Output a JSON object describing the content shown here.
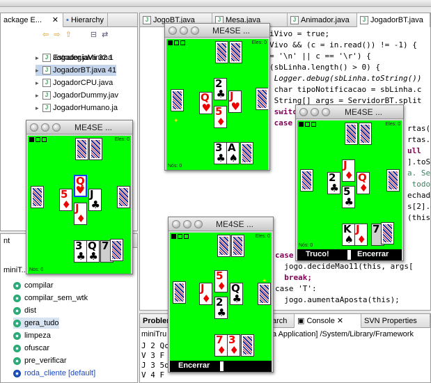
{
  "eclipse": {
    "left_tabs": [
      "ackage E...",
      "Hierarchy"
    ],
    "editor_tabs": [
      "JogoBT.java",
      "Mesa.java",
      "Animador.java",
      "JogadorBT.java"
    ],
    "tree_items": [
      {
        "label": "EstrategiaMinima"
      },
      {
        "label": "Jogador.java 32 1"
      },
      {
        "label": "JogadorBT.java 41"
      },
      {
        "label": "JogadorCPU.java"
      },
      {
        "label": "JogadorDummy.jav"
      },
      {
        "label": "JogadorHumano.ja"
      }
    ],
    "ant_tab": "nt",
    "ant_root": "miniT...",
    "ant_targets": [
      "compilar",
      "compilar_sem_wtk",
      "dist",
      "gera_tudo",
      "limpeza",
      "ofuscar",
      "pre_verificar",
      "roda_cliente [default]"
    ],
    "code_lines": [
      "iVivo = true;",
      "Vivo && (c = in.read()) != -1) {",
      "= '\\n' || c == '\\r') {",
      "(sbLinha.length() > 0) {",
      " Logger.debug(sbLinha.toString())",
      " char tipoNotificacao = sbLinha.c",
      " String[] args = ServidorBT.split",
      " switch",
      " case"
    ],
    "code_lines_lower": [
      "case",
      "  jogo.decideMao11(this, args[",
      "  break;",
      "case 'T':",
      "  jogo.aumentaAposta(this);"
    ],
    "code_fragments": [
      "rtas(",
      "rtas.l",
      "ull",
      "].toS",
      "a. Se",
      " todos",
      "echada",
      "s[2].e",
      "(this,"
    ],
    "bottom_tabs": [
      "Problem",
      "arch",
      "Console",
      "SVN Properties"
    ],
    "console_header": "miniTru",
    "console_path": "a Application] /System/Library/Framework",
    "console_lines": [
      "J 2 Qc",
      "V 3 F",
      "J 3 5o",
      "V 4 F"
    ]
  },
  "emulators": [
    {
      "title": "ME4SE ...",
      "score_label": "Eles: 0",
      "us_label": "Nós: 0"
    },
    {
      "title": "ME4SE ...",
      "score_label": "Eles: 0",
      "us_label": "Nós: 0"
    },
    {
      "title": "ME4SE ...",
      "score_label": "Eles: 0",
      "us_label": "Nós: 0",
      "softkeys": [
        "Truco!",
        "Encerrar"
      ]
    },
    {
      "title": "ME4SE ...",
      "score_label": "Eles: 0",
      "us_label": "Nós: 0",
      "softkeys": [
        "Encerrar"
      ]
    }
  ],
  "cards": {
    "w1_table": [
      {
        "r": "Q",
        "s": "♥",
        "c": "red"
      },
      {
        "r": "2",
        "s": "♣",
        "c": "blk"
      },
      {
        "r": "J",
        "s": "♥",
        "c": "red"
      },
      {
        "r": "5",
        "s": "♦",
        "c": "red"
      }
    ],
    "w1_hand": [
      {
        "r": "3",
        "s": "♣",
        "c": "blk"
      },
      {
        "r": "A",
        "s": "♠",
        "c": "blk"
      }
    ],
    "w2_table": [
      {
        "r": "Q",
        "s": "♥",
        "c": "red"
      },
      {
        "r": "5",
        "s": "♦",
        "c": "red"
      },
      {
        "r": "J",
        "s": "♣",
        "c": "blk"
      },
      {
        "r": "J",
        "s": "♦",
        "c": "red"
      }
    ],
    "w2_hand": [
      {
        "r": "3",
        "s": "♣",
        "c": "blk"
      },
      {
        "r": "Q",
        "s": "♣",
        "c": "blk"
      },
      {
        "r": "7",
        "s": "",
        "c": "blk"
      }
    ],
    "w3_table": [
      {
        "r": "J",
        "s": "♦",
        "c": "red"
      },
      {
        "r": "2",
        "s": "♣",
        "c": "blk"
      },
      {
        "r": "Q",
        "s": "♦",
        "c": "red"
      },
      {
        "r": "5",
        "s": "♣",
        "c": "blk"
      }
    ],
    "w3_hand": [
      {
        "r": "K",
        "s": "♠",
        "c": "blk"
      },
      {
        "r": "J",
        "s": "♦",
        "c": "red"
      },
      {
        "r": "7",
        "s": "",
        "c": "blk"
      }
    ],
    "w4_table": [
      {
        "r": "J",
        "s": "♦",
        "c": "red"
      },
      {
        "r": "5",
        "s": "♦",
        "c": "red"
      },
      {
        "r": "Q",
        "s": "♣",
        "c": "blk"
      },
      {
        "r": "2",
        "s": "♣",
        "c": "blk"
      }
    ],
    "w4_hand": [
      {
        "r": "7",
        "s": "♦",
        "c": "red"
      },
      {
        "r": "3",
        "s": "♦",
        "c": "red"
      }
    ]
  }
}
